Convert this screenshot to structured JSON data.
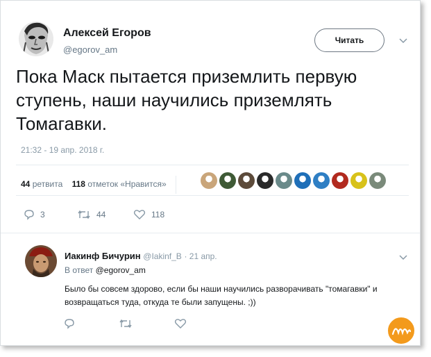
{
  "tweet": {
    "author_name": "Алексей Егоров",
    "author_handle": "@egorov_am",
    "follow_label": "Читать",
    "text": "Пока Маск пытается приземлить первую ступень, наши научились приземлять Томагавки.",
    "timestamp": "21:32 - 19 апр. 2018 г.",
    "retweets_count": "44",
    "retweets_label": "ретвита",
    "likes_count": "118",
    "likes_label": "отметок «Нравится»",
    "actions": {
      "replies": "3",
      "retweets": "44",
      "likes": "118"
    }
  },
  "reply": {
    "author_name": "Иакинф Бичурин",
    "author_handle": "@Iakinf_B",
    "date": "· 21 апр.",
    "in_reply_prefix": "В ответ",
    "in_reply_handle": "@egorov_am",
    "text": "Было бы совсем здорово, если бы наши научились разворачивать \"томагавки\" и возвращаться туда, откуда те были запущены. ;))"
  },
  "colors": {
    "text_primary": "#14171a",
    "text_secondary": "#657786",
    "icon_gray": "#8899a6",
    "divider": "#e6ecf0",
    "badge_orange": "#f39a1c"
  },
  "liker_colors": [
    "#c9a57a",
    "#3f5a36",
    "#5c4a3a",
    "#2a2a2a",
    "#6a8a8a",
    "#1f6fb8",
    "#2f7fc4",
    "#b22a1f",
    "#d8c21a",
    "#7a8a7a"
  ],
  "icons": [
    "caret-down-icon",
    "reply-icon",
    "retweet-icon",
    "like-icon",
    "watermark-badge"
  ]
}
